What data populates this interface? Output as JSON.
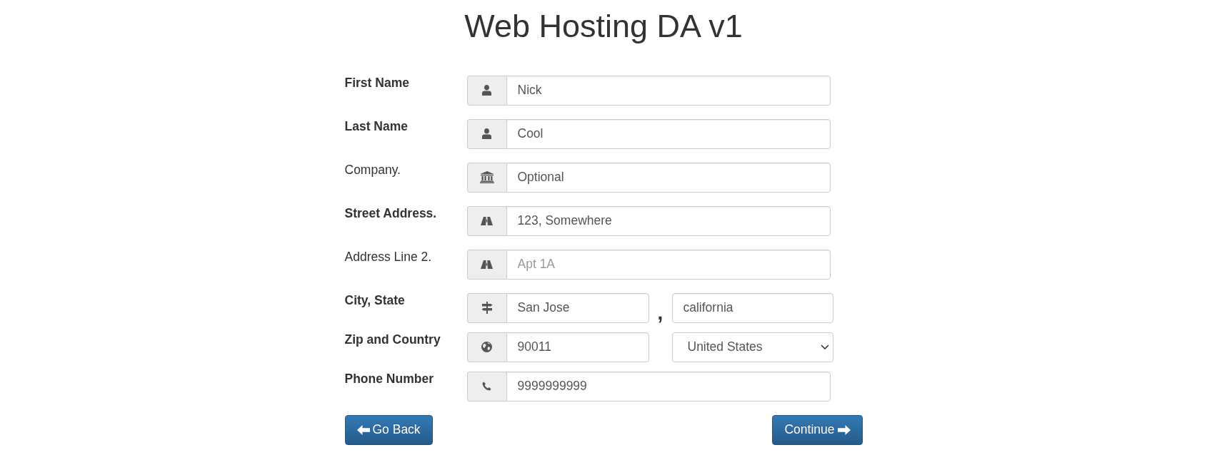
{
  "title": "Web Hosting DA v1",
  "fields": [
    {
      "kind": "name",
      "label": "First Name",
      "required": true,
      "value": "Nick"
    },
    {
      "kind": "name",
      "label": "Last Name",
      "required": true,
      "value": "Cool"
    },
    {
      "kind": "company",
      "label": "Company.",
      "required": false,
      "value": "Optional"
    },
    {
      "kind": "address",
      "label": "Street Address.",
      "required": true,
      "value": "123, Somewhere"
    },
    {
      "kind": "address",
      "label": "Address Line 2.",
      "required": false,
      "placeholder": "Apt 1A"
    },
    {
      "kind": "city",
      "label": "City, State",
      "required": true,
      "value": "San Jose",
      "separator": ",",
      "second_value": "california"
    },
    {
      "kind": "zip",
      "label": "Zip and Country",
      "required": true,
      "value": "90011",
      "second_value": "United States"
    },
    {
      "kind": "phone",
      "label": "Phone Number",
      "required": true,
      "value": "9999999999"
    }
  ],
  "buttons": [
    {
      "kind": "back",
      "label": "Go Back"
    },
    {
      "kind": "next",
      "label": "Continue"
    }
  ]
}
